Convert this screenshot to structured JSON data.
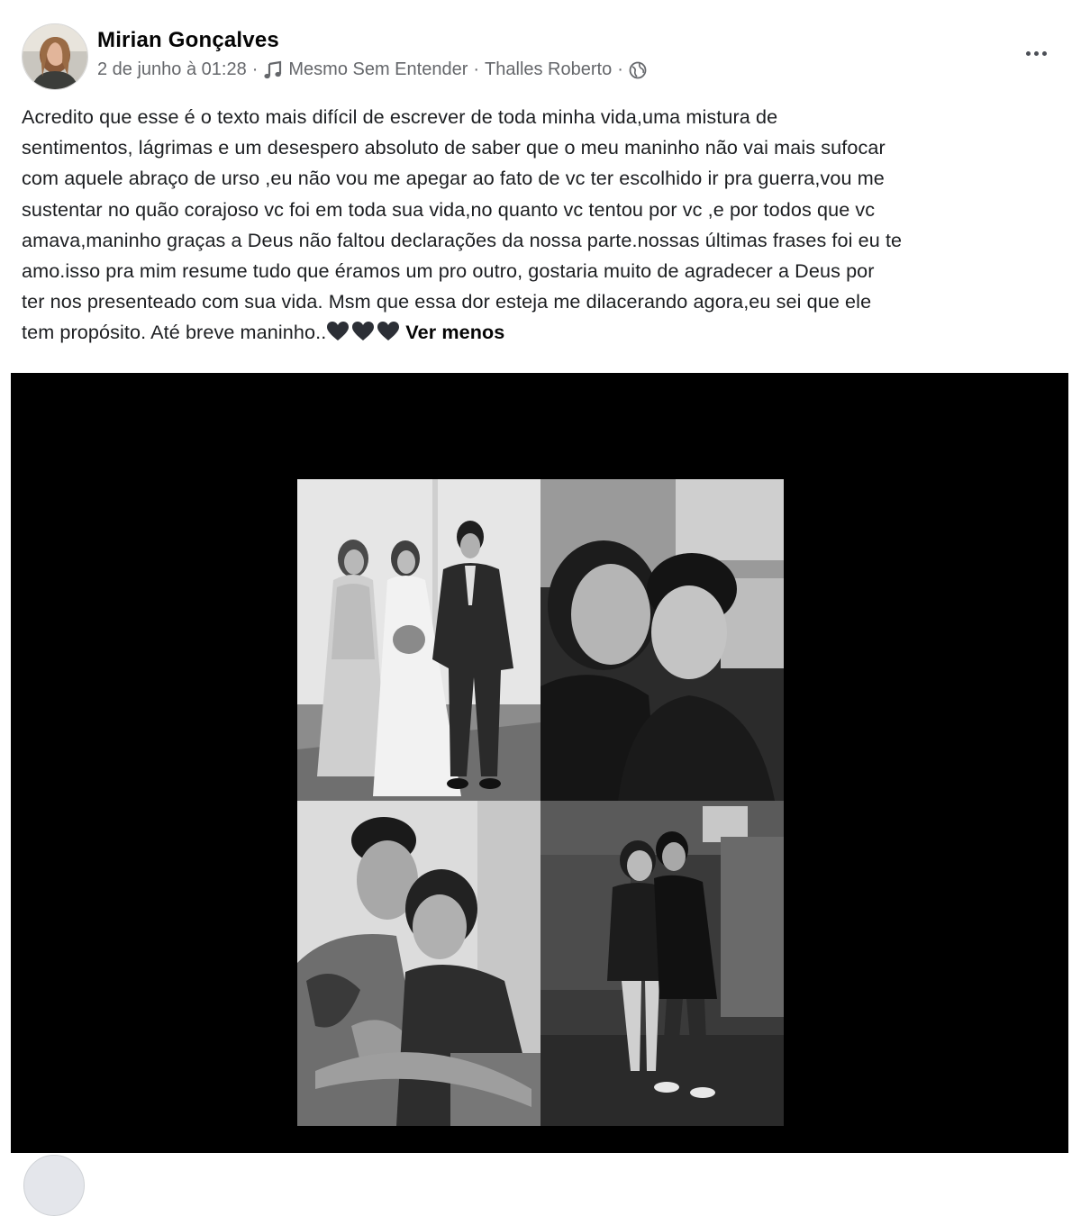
{
  "post": {
    "author": "Mirian Gonçalves",
    "date": "2 de junho à 01:28",
    "song": "Mesmo Sem Entender",
    "artist": "Thalles Roberto",
    "dot": "·",
    "text_lines": [
      "Acredito que esse é o texto mais difícil de escrever de toda minha vida,uma mistura de",
      "sentimentos, lágrimas e um desespero absoluto de saber que o meu maninho não vai mais sufocar",
      "com aquele abraço de urso ,eu não vou me apegar ao fato de vc ter escolhido ir pra guerra,vou me",
      "sustentar no quão corajoso vc foi em toda sua vida,no quanto vc tentou por vc ,e por todos que vc",
      "amava,maninho graças a Deus não faltou declarações da nossa parte.nossas últimas frases foi eu te",
      "amo.isso pra mim resume tudo que éramos um pro outro, gostaria muito de agradecer a Deus por",
      "ter nos presenteado com sua vida. Msm que essa dor esteja me dilacerando agora,eu sei que ele"
    ],
    "last_line": "tem propósito. Até breve maninho..",
    "see_less": "Ver menos"
  },
  "icons": {
    "audience": "globe-icon",
    "music": "music-note-icon",
    "more": "more-options-icon",
    "emoji": "black-heart-icon"
  },
  "colors": {
    "meta_text": "#65676b",
    "media_background": "#000000"
  }
}
